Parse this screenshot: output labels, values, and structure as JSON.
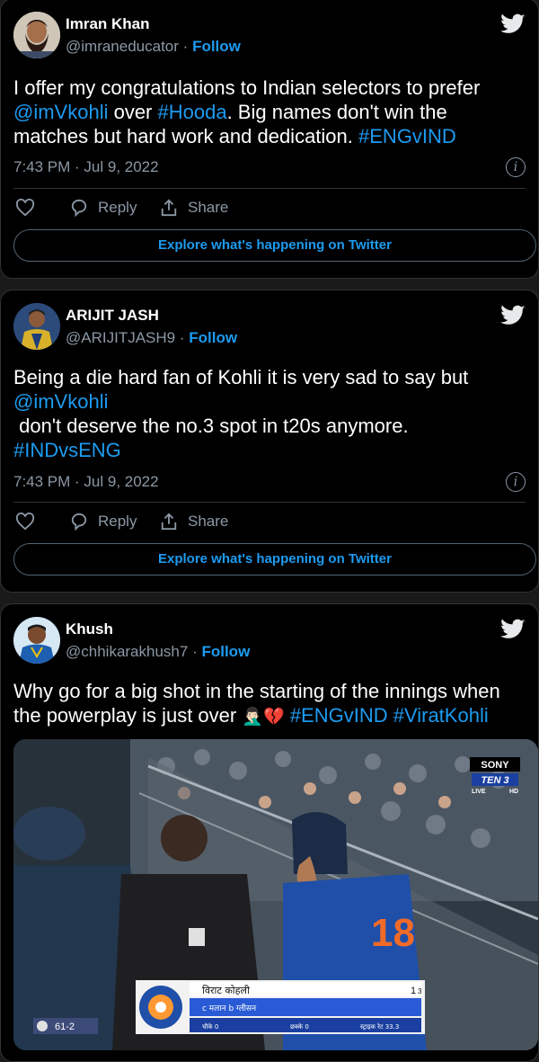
{
  "tweets": [
    {
      "name": "Imran Khan",
      "handle": "@imraneducator",
      "follow": "Follow",
      "text_parts": [
        "I offer my congratulations to Indian selectors to prefer ",
        "@imVkohli",
        " over ",
        "#Hooda",
        ". Big names don't win the matches but hard work and dedication. ",
        "#ENGvIND"
      ],
      "time": "7:43 PM · Jul 9, 2022",
      "reply": "Reply",
      "share": "Share",
      "explore": "Explore what's happening on Twitter"
    },
    {
      "name": "ARIJIT JASH",
      "handle": "@ARIJITJASH9",
      "follow": "Follow",
      "line1": "Being a die hard fan of Kohli it is very sad to say but",
      "mention": "@imVkohli",
      "line3": " don't deserve the no.3 spot in t20s anymore.",
      "hashtag": "#INDvsENG",
      "time": "7:43 PM · Jul 9, 2022",
      "reply": "Reply",
      "share": "Share",
      "explore": "Explore what's happening on Twitter"
    },
    {
      "name": "Khush",
      "handle": "@chhikarakhush7",
      "follow": "Follow",
      "line1": "Why go for a big shot in the starting of the innings when",
      "line2": "the powerplay is just over",
      "emoji": "🤦🏻‍♂️💔",
      "tags": "#ENGvIND #ViratKohli",
      "photo": {
        "broadcaster_top": "SONY",
        "broadcaster_ch": "TEN 3",
        "live": "LIVE",
        "hd": "HD",
        "player": "विराट कोहली",
        "dismissal": "c मलान b ग्लीसन",
        "runs": "1",
        "balls": "3",
        "fours": "चौके 0",
        "sixes": "छक्के 0",
        "strike_rate": "स्ट्राइक रेट 33.3",
        "score": "61-2",
        "shirt_number": "18"
      }
    }
  ],
  "colors": {
    "accent": "#1d9bf0",
    "card_bg": "#000000",
    "muted": "#8b98a5",
    "page_bg": "#1a1a1a"
  }
}
